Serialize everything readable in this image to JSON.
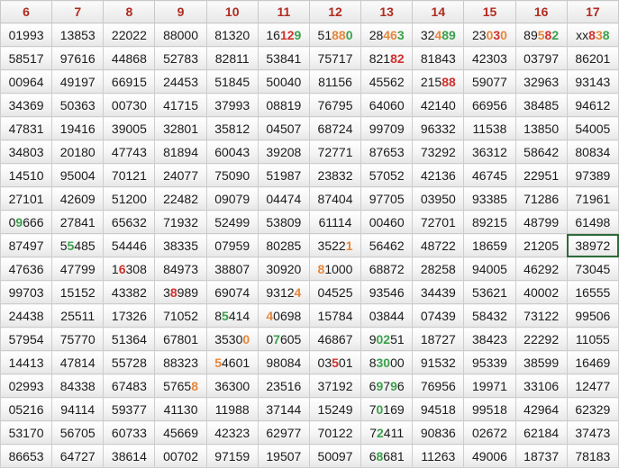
{
  "colors": {
    "red": "#d0312d",
    "green": "#3aa14a",
    "orange": "#e8873a"
  },
  "headers": [
    "6",
    "7",
    "8",
    "9",
    "10",
    "11",
    "12",
    "13",
    "14",
    "15",
    "16",
    "17"
  ],
  "rows": [
    [
      "01993",
      "13853",
      "22022",
      "88000",
      "81320",
      "16129",
      "51880",
      "28463",
      "32489",
      "23030",
      "89582",
      "xx838"
    ],
    [
      "58517",
      "97616",
      "44868",
      "52783",
      "82811",
      "53841",
      "75717",
      "82182",
      "81843",
      "42303",
      "03797",
      "86201"
    ],
    [
      "00964",
      "49197",
      "66915",
      "24453",
      "51845",
      "50040",
      "81156",
      "45562",
      "21588",
      "59077",
      "32963",
      "93143"
    ],
    [
      "34369",
      "50363",
      "00730",
      "41715",
      "37993",
      "08819",
      "76795",
      "64060",
      "42140",
      "66956",
      "38485",
      "94612"
    ],
    [
      "47831",
      "19416",
      "39005",
      "32801",
      "35812",
      "04507",
      "68724",
      "99709",
      "96332",
      "11538",
      "13850",
      "54005"
    ],
    [
      "34803",
      "20180",
      "47743",
      "81894",
      "60043",
      "39208",
      "72771",
      "87653",
      "73292",
      "36312",
      "58642",
      "80834"
    ],
    [
      "14510",
      "95004",
      "70121",
      "24077",
      "75090",
      "51987",
      "23832",
      "57052",
      "42136",
      "46745",
      "22951",
      "97389"
    ],
    [
      "27101",
      "42609",
      "51200",
      "22482",
      "09079",
      "04474",
      "87404",
      "97705",
      "03950",
      "93385",
      "71286",
      "71961"
    ],
    [
      "09666",
      "27841",
      "65632",
      "71932",
      "52499",
      "53809",
      "61114",
      "00460",
      "72701",
      "89215",
      "48799",
      "61498"
    ],
    [
      "87497",
      "55485",
      "54446",
      "38335",
      "07959",
      "80285",
      "35221",
      "56462",
      "48722",
      "18659",
      "21205",
      "38972"
    ],
    [
      "47636",
      "47799",
      "16308",
      "84973",
      "38807",
      "30920",
      "81000",
      "68872",
      "28258",
      "94005",
      "46292",
      "73045"
    ],
    [
      "99703",
      "15152",
      "43382",
      "38989",
      "69074",
      "93124",
      "04525",
      "93546",
      "34439",
      "53621",
      "40002",
      "16555"
    ],
    [
      "24438",
      "25511",
      "17326",
      "71052",
      "85414",
      "40698",
      "15784",
      "03844",
      "07439",
      "58432",
      "73122",
      "99506"
    ],
    [
      "57954",
      "75770",
      "51364",
      "67801",
      "35300",
      "07605",
      "46867",
      "90251",
      "18727",
      "38423",
      "22292",
      "11055"
    ],
    [
      "14413",
      "47814",
      "55728",
      "88323",
      "54601",
      "98084",
      "03501",
      "83000",
      "91532",
      "95339",
      "38599",
      "16469"
    ],
    [
      "02993",
      "84338",
      "67483",
      "57658",
      "36300",
      "23516",
      "37192",
      "69796",
      "76956",
      "19971",
      "33106",
      "12477"
    ],
    [
      "05216",
      "94114",
      "59377",
      "41130",
      "11988",
      "37144",
      "15249",
      "70169",
      "94518",
      "99518",
      "42964",
      "62329"
    ],
    [
      "53170",
      "56705",
      "60733",
      "45669",
      "42323",
      "62977",
      "70122",
      "72411",
      "90836",
      "02672",
      "62184",
      "37473"
    ],
    [
      "86653",
      "64727",
      "38614",
      "00702",
      "97159",
      "19507",
      "50097",
      "68681",
      "11263",
      "49006",
      "18737",
      "78183"
    ]
  ],
  "highlights": [
    {
      "r": 0,
      "c": 5,
      "s": 2,
      "n": 2,
      "color": "red"
    },
    {
      "r": 0,
      "c": 5,
      "s": 4,
      "n": 1,
      "color": "green"
    },
    {
      "r": 0,
      "c": 6,
      "s": 2,
      "n": 2,
      "color": "orange"
    },
    {
      "r": 0,
      "c": 6,
      "s": 4,
      "n": 1,
      "color": "green"
    },
    {
      "r": 0,
      "c": 7,
      "s": 2,
      "n": 2,
      "color": "orange"
    },
    {
      "r": 0,
      "c": 7,
      "s": 4,
      "n": 1,
      "color": "green"
    },
    {
      "r": 0,
      "c": 8,
      "s": 2,
      "n": 1,
      "color": "orange"
    },
    {
      "r": 0,
      "c": 8,
      "s": 3,
      "n": 2,
      "color": "green"
    },
    {
      "r": 0,
      "c": 9,
      "s": 2,
      "n": 1,
      "color": "orange"
    },
    {
      "r": 0,
      "c": 9,
      "s": 3,
      "n": 1,
      "color": "red"
    },
    {
      "r": 0,
      "c": 9,
      "s": 4,
      "n": 1,
      "color": "orange"
    },
    {
      "r": 0,
      "c": 10,
      "s": 2,
      "n": 1,
      "color": "orange"
    },
    {
      "r": 0,
      "c": 10,
      "s": 3,
      "n": 1,
      "color": "red"
    },
    {
      "r": 0,
      "c": 10,
      "s": 4,
      "n": 1,
      "color": "green"
    },
    {
      "r": 0,
      "c": 11,
      "s": 2,
      "n": 1,
      "color": "red"
    },
    {
      "r": 0,
      "c": 11,
      "s": 3,
      "n": 1,
      "color": "orange"
    },
    {
      "r": 0,
      "c": 11,
      "s": 4,
      "n": 1,
      "color": "green"
    },
    {
      "r": 1,
      "c": 7,
      "s": 3,
      "n": 2,
      "color": "red"
    },
    {
      "r": 2,
      "c": 8,
      "s": 3,
      "n": 2,
      "color": "red"
    },
    {
      "r": 8,
      "c": 0,
      "s": 1,
      "n": 1,
      "color": "green"
    },
    {
      "r": 9,
      "c": 1,
      "s": 1,
      "n": 1,
      "color": "green"
    },
    {
      "r": 9,
      "c": 6,
      "s": 4,
      "n": 1,
      "color": "orange"
    },
    {
      "r": 10,
      "c": 2,
      "s": 1,
      "n": 1,
      "color": "red"
    },
    {
      "r": 10,
      "c": 6,
      "s": 0,
      "n": 1,
      "color": "orange"
    },
    {
      "r": 11,
      "c": 3,
      "s": 1,
      "n": 1,
      "color": "red"
    },
    {
      "r": 11,
      "c": 5,
      "s": 4,
      "n": 1,
      "color": "orange"
    },
    {
      "r": 12,
      "c": 4,
      "s": 1,
      "n": 1,
      "color": "green"
    },
    {
      "r": 12,
      "c": 5,
      "s": 0,
      "n": 1,
      "color": "orange"
    },
    {
      "r": 13,
      "c": 4,
      "s": 4,
      "n": 1,
      "color": "orange"
    },
    {
      "r": 13,
      "c": 5,
      "s": 1,
      "n": 1,
      "color": "green"
    },
    {
      "r": 13,
      "c": 7,
      "s": 1,
      "n": 2,
      "color": "green"
    },
    {
      "r": 14,
      "c": 4,
      "s": 0,
      "n": 1,
      "color": "orange"
    },
    {
      "r": 14,
      "c": 6,
      "s": 2,
      "n": 1,
      "color": "red"
    },
    {
      "r": 14,
      "c": 7,
      "s": 1,
      "n": 2,
      "color": "green"
    },
    {
      "r": 15,
      "c": 3,
      "s": 4,
      "n": 1,
      "color": "orange"
    },
    {
      "r": 15,
      "c": 7,
      "s": 1,
      "n": 1,
      "color": "green"
    },
    {
      "r": 15,
      "c": 7,
      "s": 3,
      "n": 1,
      "color": "green"
    },
    {
      "r": 16,
      "c": 7,
      "s": 1,
      "n": 1,
      "color": "green"
    },
    {
      "r": 17,
      "c": 7,
      "s": 1,
      "n": 1,
      "color": "green"
    },
    {
      "r": 18,
      "c": 7,
      "s": 1,
      "n": 1,
      "color": "green"
    }
  ],
  "selected": {
    "r": 9,
    "c": 11
  }
}
